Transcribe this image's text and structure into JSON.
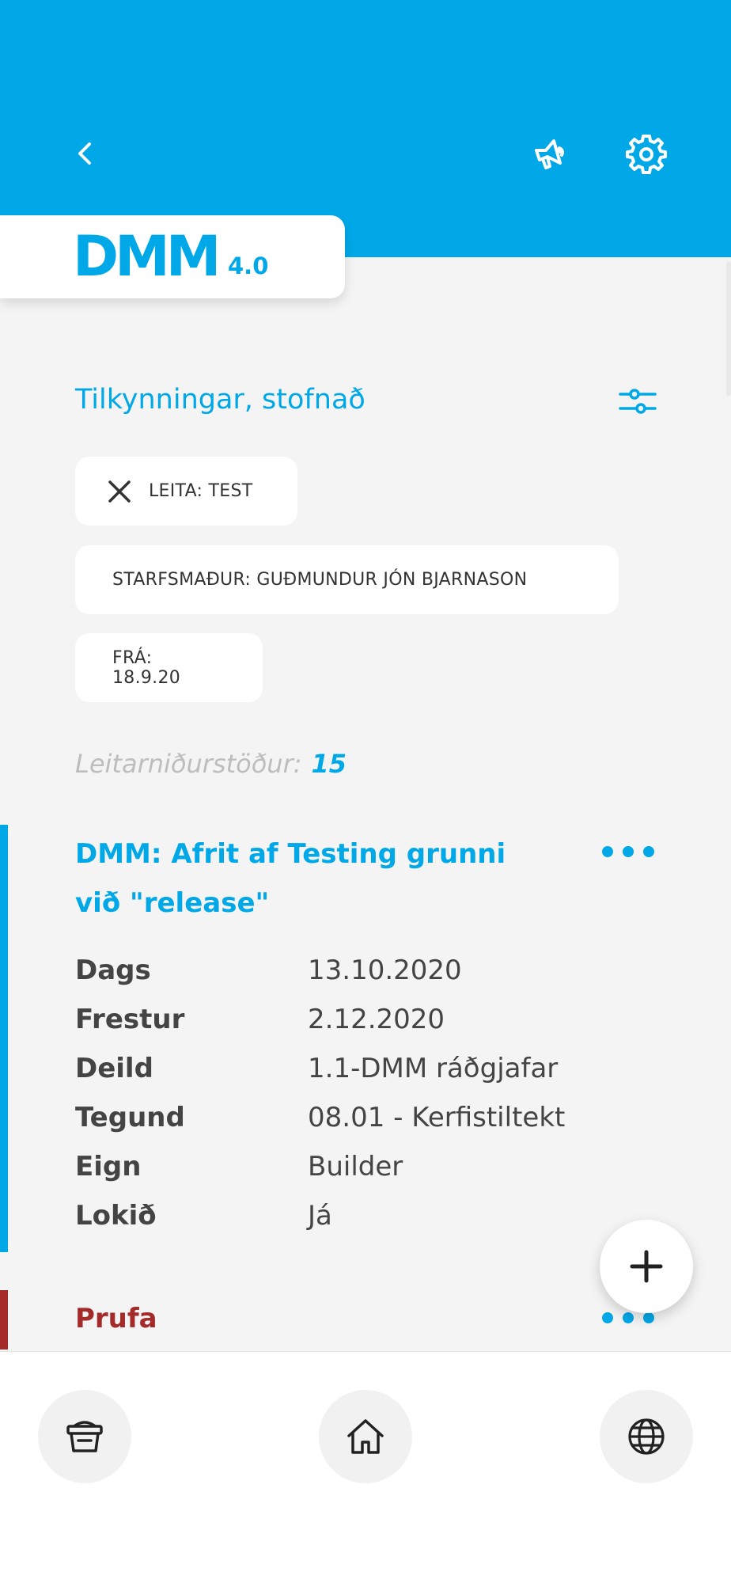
{
  "header": {
    "logo": "DMM",
    "version": "4.0",
    "icons": [
      "chevron-left-icon",
      "megaphone-icon",
      "gear-icon"
    ],
    "background_color": "#00a8e8"
  },
  "page": {
    "title": "Tilkynningar, stofnað",
    "filter_icon": "sliders-icon"
  },
  "filters": [
    {
      "label": "LEITA: TEST",
      "removable": true
    },
    {
      "label": "STARFSMAÐUR: GUÐMUNDUR JÓN BJARNASON"
    },
    {
      "label": "FRÁ: 18.9.20"
    }
  ],
  "results": {
    "label": "Leitarniðurstöður:",
    "count": "15"
  },
  "items": [
    {
      "title": "DMM: Afrit af Testing grunni við \"release\"",
      "accent_color": "#00a8e8",
      "fields": [
        {
          "label": "Dags",
          "value": "13.10.2020"
        },
        {
          "label": "Frestur",
          "value": "2.12.2020"
        },
        {
          "label": "Deild",
          "value": "1.1-DMM ráðgjafar"
        },
        {
          "label": "Tegund",
          "value": "08.01 - Kerfistiltekt"
        },
        {
          "label": "Eign",
          "value": "Builder"
        },
        {
          "label": "Lokið",
          "value": "Já"
        }
      ]
    },
    {
      "title": "Prufa",
      "accent_color": "#a52a2a"
    }
  ],
  "fab_icon": "plus-icon",
  "bottom_nav": [
    {
      "icon": "basket-icon"
    },
    {
      "icon": "home-icon"
    },
    {
      "icon": "globe-icon"
    }
  ]
}
